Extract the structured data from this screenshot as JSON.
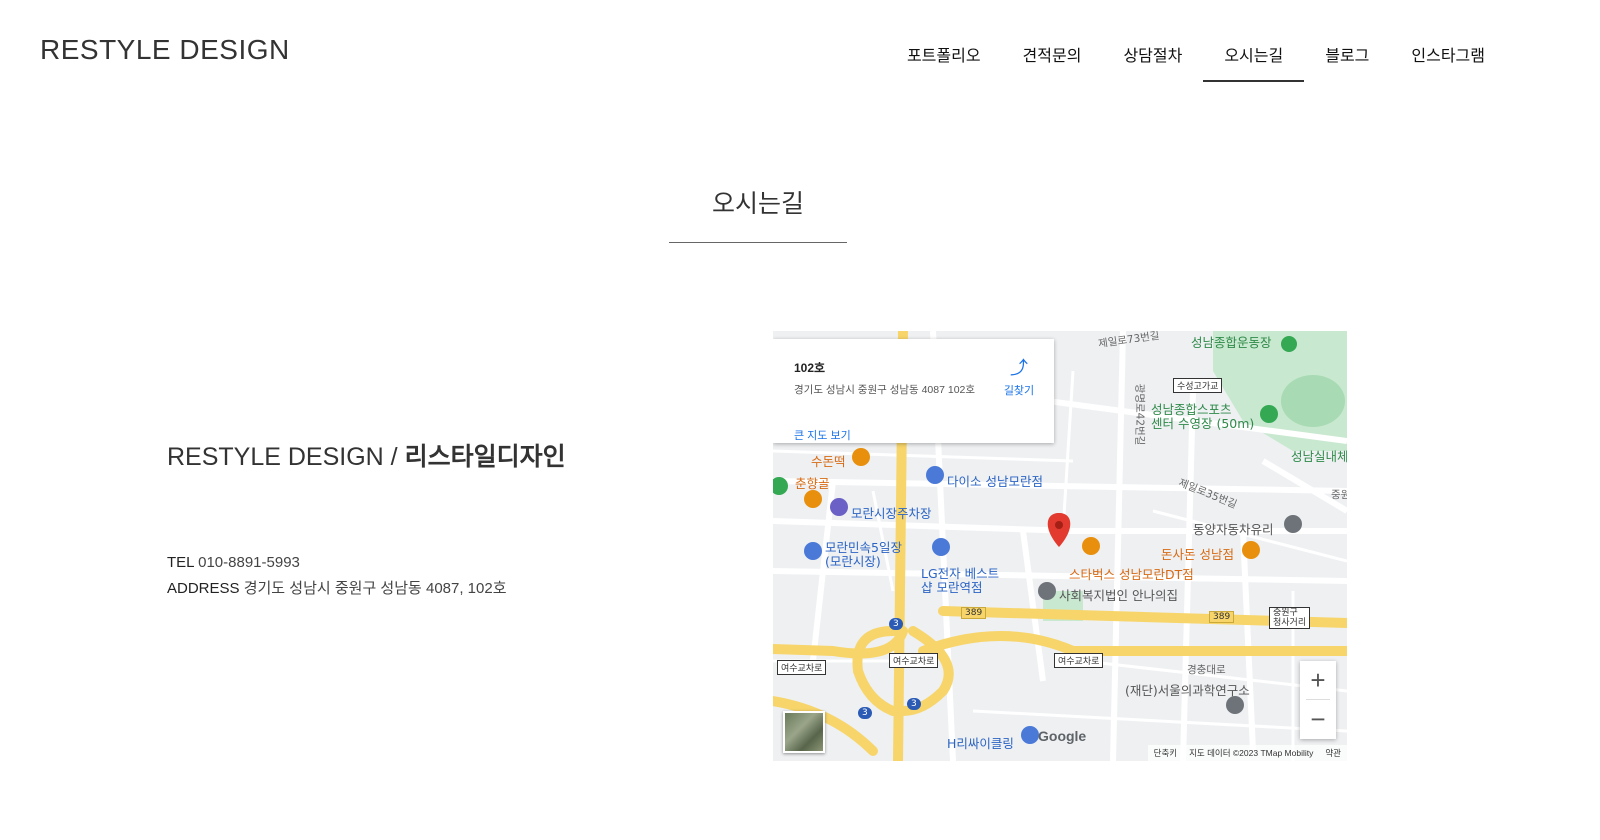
{
  "header": {
    "logo": "RESTYLE DESIGN",
    "nav": [
      {
        "label": "포트폴리오"
      },
      {
        "label": "견적문의"
      },
      {
        "label": "상담절차"
      },
      {
        "label": "오시는길",
        "active": true
      },
      {
        "label": "블로그"
      },
      {
        "label": "인스타그램"
      }
    ]
  },
  "section": {
    "title": "오시는길"
  },
  "company": {
    "name_en": "RESTYLE DESIGN / ",
    "name_ko": "리스타일디자인"
  },
  "contact": {
    "tel_label": "TEL",
    "tel_value": "010-8891-5993",
    "address_label": "ADDRESS",
    "address_value": "경기도 성남시 중원구 성남동 4087, 102호"
  },
  "map": {
    "info": {
      "title": "102호",
      "address": "경기도 성남시 중원구 성남동 4087 102호",
      "view_larger": "큰 지도 보기",
      "directions": "길찾기"
    },
    "labels": {
      "sports_complex": "성남종합운동장",
      "pool": "성남종합스포츠\n센터 수영장 (50m)",
      "indoor": "성남실내체",
      "sudonduk": "수돈떡",
      "chunhyang": "춘향골",
      "daiso": "다이소 성남모란점",
      "parking": "모란시장주차장",
      "market": "모란민속5일장\n(모란시장)",
      "lg": "LG전자 베스트\n샵 모란역점",
      "starbucks": "스타벅스 성남모란DT점",
      "donsadon": "돈사돈 성남점",
      "dongyang": "동양자동차유리",
      "social": "사회복지법인 안나의집",
      "institute": "(재단)서울의과학연구소",
      "hbike": "H리싸이클링",
      "road_73": "제일로73번길",
      "road_35": "제일로35번길",
      "road_42": "광명로42번길",
      "gyeongchung": "경충대로",
      "box_susung": "수성고가교",
      "box_yeosu1": "여수교차로",
      "box_yeosu2": "여수교차로",
      "box_yeosu3": "여수교차로",
      "box_jungwon": "중원구\n청사거리",
      "jungwon": "중원도",
      "route_389": "389",
      "route_3": "3"
    },
    "google": "Google",
    "footer": [
      "단축키",
      "지도 데이터 ©2023 TMap Mobility",
      "약관"
    ],
    "zoom_in": "+",
    "zoom_out": "−"
  },
  "colors": {
    "accent": "#1a73e8",
    "road_major": "#f7d56a",
    "park": "#c8e8cf",
    "pin": "#e23a2e"
  }
}
